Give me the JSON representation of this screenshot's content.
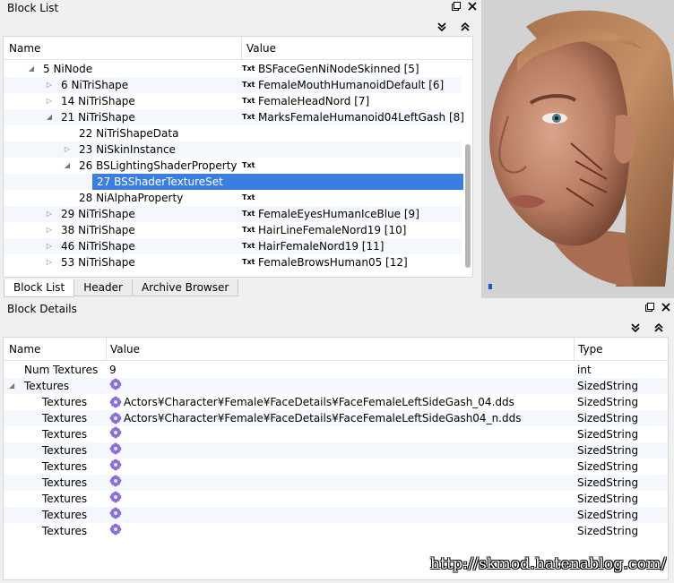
{
  "blocklist": {
    "title": "Block List",
    "float_icon": "float-window-icon",
    "close_icon": "close-icon",
    "columns": {
      "name": "Name",
      "value": "Value"
    },
    "rows": [
      {
        "indent": 1,
        "arrow": "expanded",
        "name": "5 NiNode",
        "txt": "Txt",
        "value": "BSFaceGenNiNodeSkinned [5]"
      },
      {
        "indent": 2,
        "arrow": "collapsed",
        "name": "6 NiTriShape",
        "txt": "Txt",
        "value": "FemaleMouthHumanoidDefault [6]"
      },
      {
        "indent": 2,
        "arrow": "collapsed",
        "name": "14 NiTriShape",
        "txt": "Txt",
        "value": "FemaleHeadNord [7]"
      },
      {
        "indent": 2,
        "arrow": "expanded",
        "name": "21 NiTriShape",
        "txt": "Txt",
        "value": "MarksFemaleHumanoid04LeftGash [8]"
      },
      {
        "indent": 3,
        "arrow": "none",
        "name": "22 NiTriShapeData",
        "txt": "",
        "value": ""
      },
      {
        "indent": 3,
        "arrow": "collapsed",
        "name": "23 NiSkinInstance",
        "txt": "",
        "value": ""
      },
      {
        "indent": 3,
        "arrow": "expanded",
        "name": "26 BSLightingShaderProperty",
        "txt": "Txt",
        "value": ""
      },
      {
        "indent": 4,
        "arrow": "none",
        "name": "27 BSShaderTextureSet",
        "txt": "",
        "value": "",
        "selected": true
      },
      {
        "indent": 3,
        "arrow": "none",
        "name": "28 NiAlphaProperty",
        "txt": "Txt",
        "value": ""
      },
      {
        "indent": 2,
        "arrow": "collapsed",
        "name": "29 NiTriShape",
        "txt": "Txt",
        "value": "FemaleEyesHumanIceBlue [9]"
      },
      {
        "indent": 2,
        "arrow": "collapsed",
        "name": "38 NiTriShape",
        "txt": "Txt",
        "value": "HairLineFemaleNord19 [10]"
      },
      {
        "indent": 2,
        "arrow": "collapsed",
        "name": "46 NiTriShape",
        "txt": "Txt",
        "value": "HairFemaleNord19 [11]"
      },
      {
        "indent": 2,
        "arrow": "collapsed",
        "name": "53 NiTriShape",
        "txt": "Txt",
        "value": "FemaleBrowsHuman05 [12]"
      }
    ],
    "tabs": [
      "Block List",
      "Header",
      "Archive Browser"
    ],
    "active_tab": "Block List"
  },
  "details": {
    "title": "Block Details",
    "columns": {
      "name": "Name",
      "value": "Value",
      "type": "Type"
    },
    "rows": [
      {
        "indent": 0,
        "arrow": "none",
        "name": "Num Textures",
        "icon": false,
        "value": "9",
        "type": "int"
      },
      {
        "indent": 0,
        "arrow": "expanded",
        "name": "Textures",
        "icon": true,
        "value": "",
        "type": "SizedString"
      },
      {
        "indent": 1,
        "arrow": "none",
        "name": "Textures",
        "icon": true,
        "value": "Actors¥Character¥Female¥FaceDetails¥FaceFemaleLeftSideGash_04.dds",
        "type": "SizedString"
      },
      {
        "indent": 1,
        "arrow": "none",
        "name": "Textures",
        "icon": true,
        "value": "Actors¥Character¥Female¥FaceDetails¥FaceFemaleLeftSideGash04_n.dds",
        "type": "SizedString"
      },
      {
        "indent": 1,
        "arrow": "none",
        "name": "Textures",
        "icon": true,
        "value": "",
        "type": "SizedString"
      },
      {
        "indent": 1,
        "arrow": "none",
        "name": "Textures",
        "icon": true,
        "value": "",
        "type": "SizedString"
      },
      {
        "indent": 1,
        "arrow": "none",
        "name": "Textures",
        "icon": true,
        "value": "",
        "type": "SizedString"
      },
      {
        "indent": 1,
        "arrow": "none",
        "name": "Textures",
        "icon": true,
        "value": "",
        "type": "SizedString"
      },
      {
        "indent": 1,
        "arrow": "none",
        "name": "Textures",
        "icon": true,
        "value": "",
        "type": "SizedString"
      },
      {
        "indent": 1,
        "arrow": "none",
        "name": "Textures",
        "icon": true,
        "value": "",
        "type": "SizedString"
      },
      {
        "indent": 1,
        "arrow": "none",
        "name": "Textures",
        "icon": true,
        "value": "",
        "type": "SizedString"
      }
    ]
  },
  "watermark": "http://skmod.hatenablog.com/",
  "colors": {
    "selection": "#3a7ee0",
    "icon_flower": "#8b6fd6"
  }
}
